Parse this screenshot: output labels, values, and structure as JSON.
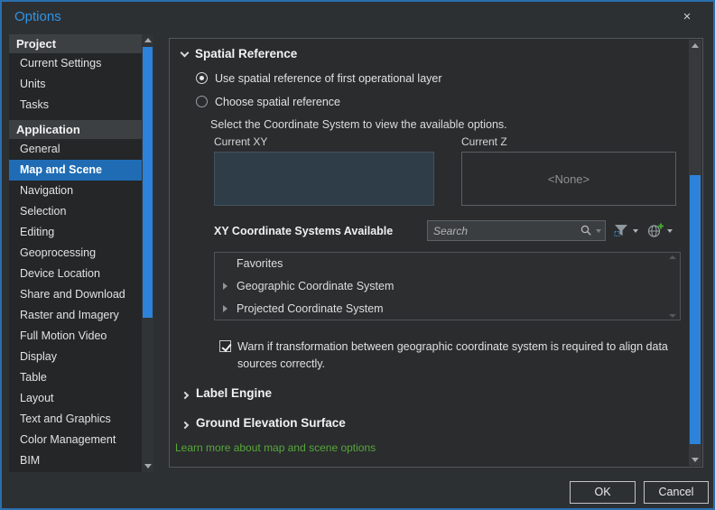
{
  "window": {
    "title": "Options",
    "close_glyph": "×"
  },
  "sidebar": {
    "sections": [
      {
        "header": "Project",
        "items": [
          "Current Settings",
          "Units",
          "Tasks"
        ]
      },
      {
        "header": "Application",
        "items": [
          "General",
          "Map and Scene",
          "Navigation",
          "Selection",
          "Editing",
          "Geoprocessing",
          "Device Location",
          "Share and Download",
          "Raster and Imagery",
          "Full Motion Video",
          "Display",
          "Table",
          "Layout",
          "Text and Graphics",
          "Color Management",
          "BIM"
        ]
      }
    ],
    "selected_item": "Map and Scene"
  },
  "main": {
    "spatial_reference": {
      "header": "Spatial Reference",
      "radio_use_first_layer": "Use spatial reference of first operational layer",
      "radio_choose": "Choose spatial reference",
      "instruction": "Select the Coordinate System to view the available options.",
      "current_xy_label": "Current XY",
      "current_z_label": "Current Z",
      "current_z_value": "<None>",
      "available_label": "XY Coordinate Systems Available",
      "search_placeholder": "Search",
      "tree_items": [
        "Favorites",
        "Geographic Coordinate System",
        "Projected Coordinate System"
      ],
      "warning_label": "Warn if transformation between geographic coordinate system is required to align data sources correctly.",
      "warning_checked": true
    },
    "collapsed_sections": [
      "Label Engine",
      "Ground Elevation Surface"
    ],
    "learn_more_link": "Learn more about map and scene options"
  },
  "footer": {
    "ok_label": "OK",
    "cancel_label": "Cancel"
  },
  "icons": [
    "close-icon",
    "search-icon",
    "filter-icon",
    "globe-add-icon",
    "dropdown-caret-icon",
    "chevron-down-icon",
    "chevron-right-icon",
    "tree-expander-icon",
    "scroll-up-icon",
    "scroll-down-icon"
  ],
  "colors": {
    "window_border_blue": "#2b6fad",
    "title_blue": "#2e95e8",
    "selected_item_blue": "#1f6cb5",
    "scrollbar_thumb_blue": "#2d83d9",
    "link_green": "#58a83a",
    "current_xy_fill": "#2e3d48",
    "panel_bg": "#2a2c2e",
    "sidebar_bg": "#242628"
  }
}
